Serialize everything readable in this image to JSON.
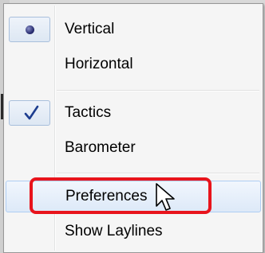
{
  "menu": {
    "items": [
      {
        "label": "Vertical",
        "state": "radio-selected",
        "icon": "bullet-icon"
      },
      {
        "label": "Horizontal",
        "state": "none"
      },
      {
        "label": "Tactics",
        "state": "checked",
        "icon": "check-icon"
      },
      {
        "label": "Barometer",
        "state": "none"
      },
      {
        "label": "Preferences",
        "state": "highlighted"
      },
      {
        "label": "Show Laylines",
        "state": "none"
      }
    ]
  },
  "annotation": {
    "highlight_color": "#e8141c",
    "target": "Preferences"
  },
  "colors": {
    "menu_background": "#f5f5f5",
    "hover_border": "#aecdf3",
    "check_color": "#1d3d8f"
  }
}
